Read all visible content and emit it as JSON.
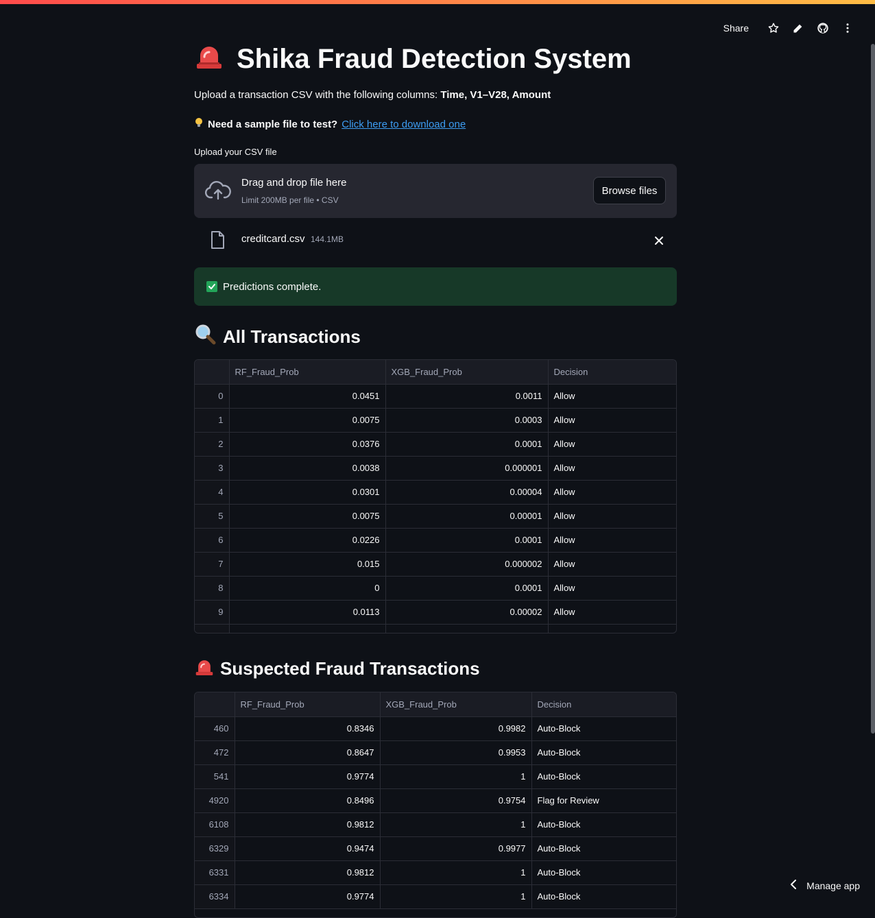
{
  "toolbar": {
    "share_label": "Share",
    "icons": [
      "star-icon",
      "pencil-icon",
      "github-icon",
      "more-vertical-icon"
    ]
  },
  "header": {
    "title": "Shika Fraud Detection System",
    "title_icon": "siren-icon"
  },
  "intro": {
    "text_prefix": "Upload a transaction CSV with the following columns: ",
    "text_bold": "Time, V1–V28, Amount",
    "sample_icon": "lightbulb-icon",
    "sample_bold": "Need a sample file to test?",
    "sample_link": "Click here to download one"
  },
  "uploader": {
    "label": "Upload your CSV file",
    "dropzone_title": "Drag and drop file here",
    "dropzone_sub": "Limit 200MB per file • CSV",
    "browse_label": "Browse files",
    "file_name": "creditcard.csv",
    "file_size": "144.1MB"
  },
  "status": {
    "message": "Predictions complete.",
    "color": "#173928"
  },
  "all_transactions": {
    "heading": "All Transactions",
    "heading_icon": "magnifier-icon",
    "columns": [
      "",
      "RF_Fraud_Prob",
      "XGB_Fraud_Prob",
      "Decision"
    ],
    "rows": [
      [
        "0",
        "0.0451",
        "0.0011",
        "Allow"
      ],
      [
        "1",
        "0.0075",
        "0.0003",
        "Allow"
      ],
      [
        "2",
        "0.0376",
        "0.0001",
        "Allow"
      ],
      [
        "3",
        "0.0038",
        "0.000001",
        "Allow"
      ],
      [
        "4",
        "0.0301",
        "0.00004",
        "Allow"
      ],
      [
        "5",
        "0.0075",
        "0.00001",
        "Allow"
      ],
      [
        "6",
        "0.0226",
        "0.0001",
        "Allow"
      ],
      [
        "7",
        "0.015",
        "0.000002",
        "Allow"
      ],
      [
        "8",
        "0",
        "0.0001",
        "Allow"
      ],
      [
        "9",
        "0.0113",
        "0.00002",
        "Allow"
      ]
    ]
  },
  "fraud_transactions": {
    "heading": "Suspected Fraud Transactions",
    "heading_icon": "siren-icon",
    "columns": [
      "",
      "RF_Fraud_Prob",
      "XGB_Fraud_Prob",
      "Decision"
    ],
    "rows": [
      [
        "460",
        "0.8346",
        "0.9982",
        "Auto-Block"
      ],
      [
        "472",
        "0.8647",
        "0.9953",
        "Auto-Block"
      ],
      [
        "541",
        "0.9774",
        "1",
        "Auto-Block"
      ],
      [
        "4920",
        "0.8496",
        "0.9754",
        "Flag for Review"
      ],
      [
        "6108",
        "0.9812",
        "1",
        "Auto-Block"
      ],
      [
        "6329",
        "0.9474",
        "0.9977",
        "Auto-Block"
      ],
      [
        "6331",
        "0.9812",
        "1",
        "Auto-Block"
      ],
      [
        "6334",
        "0.9774",
        "1",
        "Auto-Block"
      ]
    ]
  },
  "footer": {
    "manage_label": "Manage app"
  },
  "colors": {
    "background": "#0e1117",
    "accent": "#ff4b4b",
    "link": "#3d9df3"
  }
}
